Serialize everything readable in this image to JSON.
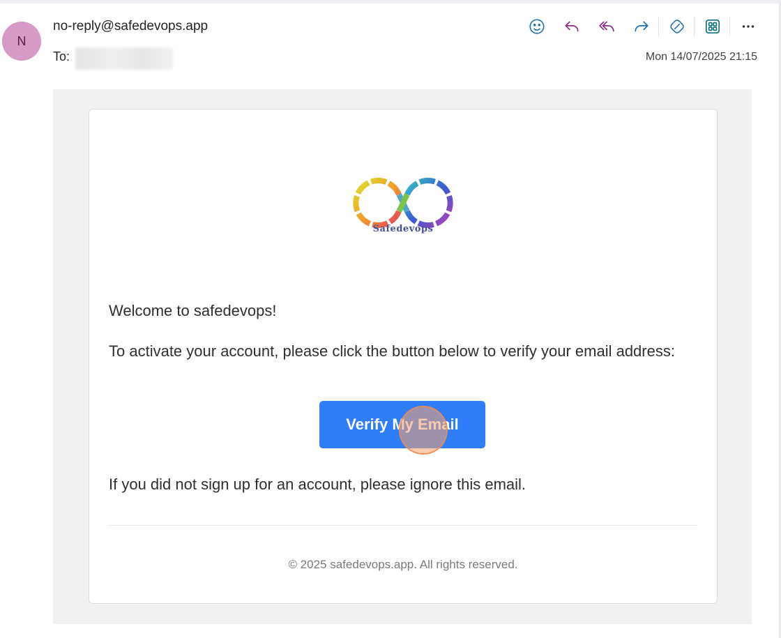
{
  "header": {
    "avatar_initial": "N",
    "sender": "no-reply@safedevops.app",
    "to_label": "To:",
    "datetime": "Mon 14/07/2025 21:15"
  },
  "toolbar": {
    "icons": [
      "emoji-icon",
      "reply-icon",
      "reply-all-icon",
      "forward-icon",
      "sticker-icon",
      "apps-icon",
      "more-icon"
    ],
    "colors": {
      "blue": "#1f6fb2",
      "purple": "#8a2f88",
      "teal": "#0f6f82"
    }
  },
  "email": {
    "logo_text": "Safedevops",
    "welcome": "Welcome to safedevops!",
    "instructions": "To activate your account, please click the button below to verify your email address:",
    "button_label": "Verify My Email",
    "ignore_text": "If you did not sign up for an account, please ignore this email.",
    "footer": "© 2025 safedevops.app. All rights reserved.",
    "button_color": "#2f7ef7"
  }
}
